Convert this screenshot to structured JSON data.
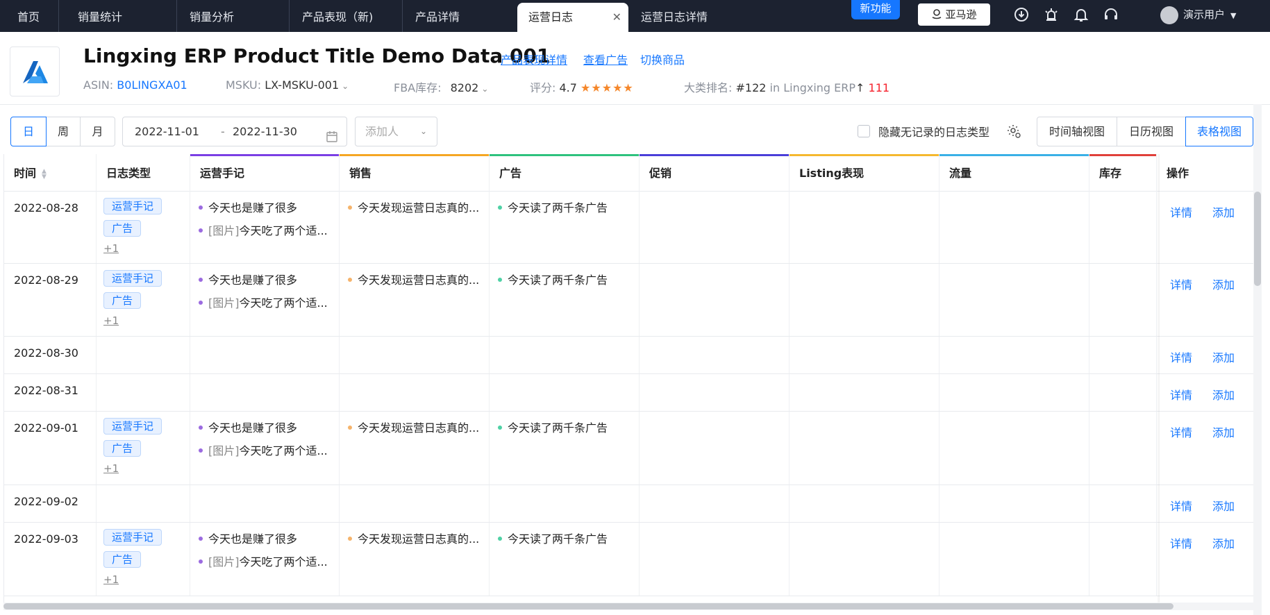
{
  "nav": {
    "tabs": [
      "首页",
      "销量统计",
      "销量分析",
      "产品表现（新)",
      "产品详情",
      "运营日志",
      "运营日志详情"
    ],
    "active_tab": "运营日志",
    "new_feature_label": "新功能",
    "marketplace_button": "亚马逊",
    "user_name": "演示用户",
    "icons": [
      "download-icon",
      "bug-icon",
      "bell-icon",
      "headset-icon"
    ]
  },
  "product": {
    "title": "Lingxing ERP Product Title Demo Data 001",
    "links": [
      "产品表现详情",
      "查看广告",
      "切换商品"
    ],
    "asin_label": "ASIN:",
    "asin": "B0LINGXA01",
    "msku_label": "MSKU:",
    "msku": "LX-MSKU-001",
    "fba_label": "FBA库存:",
    "fba": "8202",
    "rating_label": "评分:",
    "rating": "4.7",
    "stars": "★★★★★",
    "rank_label": "大类排名:",
    "rank": "#122",
    "rank_category": "in Lingxing ERP",
    "rank_change": "111"
  },
  "toolbar": {
    "periods": [
      "日",
      "周",
      "月"
    ],
    "active_period": "日",
    "date_start": "2022-11-01",
    "date_separator": "-",
    "date_end": "2022-11-30",
    "adder_placeholder": "添加人",
    "hide_empty_label": "隐藏无记录的日志类型",
    "views": [
      "时间轴视图",
      "日历视图",
      "表格视图"
    ],
    "active_view": "表格视图"
  },
  "table": {
    "columns": [
      "时间",
      "日志类型",
      "运营手记",
      "销售",
      "广告",
      "促销",
      "Listing表现",
      "流量",
      "库存",
      "操作"
    ],
    "column_colors": {
      "运营手记": "#7b3fe4",
      "销售": "#f5a623",
      "广告": "#2ec27e",
      "促销": "#4a3fd9",
      "Listing表现": "#f5b82e",
      "流量": "#3ab0e6",
      "库存": "#e0403a"
    },
    "dot_colors": {
      "note": "#9b6be0",
      "sales": "#f5b36b",
      "ads": "#4fd1a5"
    },
    "tags": [
      "运营手记",
      "广告"
    ],
    "more_label": "+1",
    "note_1": "今天也是赚了很多",
    "note_2_prefix": "[图片]",
    "note_2": "今天吃了两个适...",
    "sales_text": "今天发现运营日志真的...",
    "ads_text": "今天读了两千条广告",
    "action_detail": "详情",
    "action_add": "添加",
    "rows": [
      {
        "date": "2022-08-28",
        "has_entries": true
      },
      {
        "date": "2022-08-29",
        "has_entries": true
      },
      {
        "date": "2022-08-30",
        "has_entries": false
      },
      {
        "date": "2022-08-31",
        "has_entries": false
      },
      {
        "date": "2022-09-01",
        "has_entries": true
      },
      {
        "date": "2022-09-02",
        "has_entries": false
      },
      {
        "date": "2022-09-03",
        "has_entries": true
      }
    ]
  }
}
